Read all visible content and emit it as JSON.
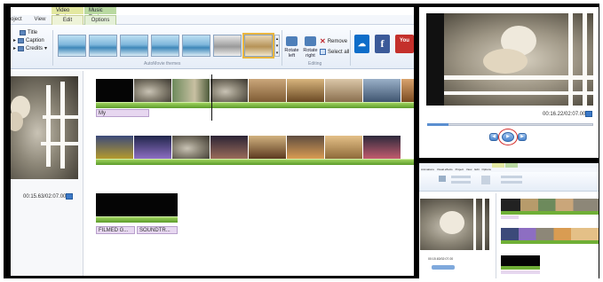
{
  "ribbon": {
    "context_tabs": [
      {
        "label": "Video Tools"
      },
      {
        "label": "Music Tools"
      }
    ],
    "tabs": [
      {
        "label": "oject"
      },
      {
        "label": "View"
      },
      {
        "label": "Edit"
      },
      {
        "label": "Options"
      }
    ],
    "text_items": [
      {
        "label": "Title"
      },
      {
        "label": "Caption"
      },
      {
        "label": "Credits"
      }
    ],
    "autotheme_group_label": "AutoMovie themes",
    "editing_group_label": "Editing",
    "rotate_left_label": "Rotate left",
    "rotate_right_label": "Rotate right",
    "remove_label": "Remove",
    "select_all_label": "Select all",
    "share_partial_label": "You"
  },
  "preview": {
    "timecode": "00:15.63/02:07.00"
  },
  "storyboard": {
    "caption_1": "My",
    "audio_captions": [
      "FILMED G...",
      "SOUNDTR..."
    ]
  },
  "right_panel": {
    "timecode": "00:16.22/02:07.00",
    "controls": {
      "prev": "◀",
      "play": "▶",
      "next": "▶"
    },
    "progress": 0.13
  },
  "thumb_panel": {
    "tabs": [
      {
        "label": "Animations"
      },
      {
        "label": "Visual effects"
      },
      {
        "label": "Project"
      },
      {
        "label": "View"
      },
      {
        "label": "Edit"
      },
      {
        "label": "Options"
      }
    ],
    "timecode": "00:15.63/02:07.00"
  },
  "colors": {
    "accent": "#3c79c7",
    "grass": "#6faf36",
    "caption_bg": "#e7d7f0",
    "video_tools_tab": "#e3e8a0",
    "music_tools_tab": "#b9d9a0"
  },
  "icons": [
    "title-icon",
    "caption-icon",
    "credits-icon",
    "rotate-left-icon",
    "rotate-right-icon",
    "remove-icon",
    "select-all-icon",
    "onedrive-icon",
    "facebook-icon",
    "youtube-icon",
    "expand-icon",
    "previous-frame-icon",
    "play-icon",
    "next-frame-icon"
  ]
}
